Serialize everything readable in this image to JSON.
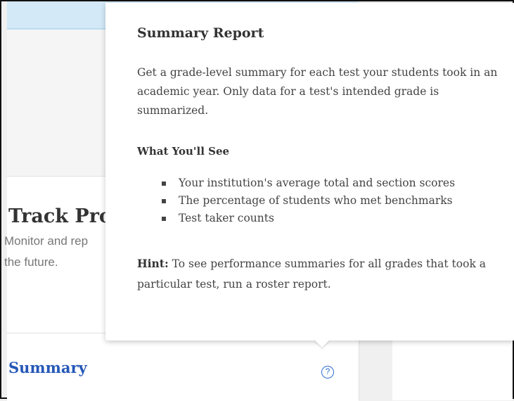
{
  "background": {
    "track_card": {
      "title": "Track Prog",
      "description": "Monitor and rep the future."
    },
    "summary_link": "Summary",
    "help_icon_glyph": "?"
  },
  "popover": {
    "title": "Summary Report",
    "body": "Get a grade-level summary for each test your students took in an academic year. Only data for a test's intended grade is summarized.",
    "subhead": "What You'll See",
    "list_items": [
      "Your institution's average total and section scores",
      "The percentage of students who met benchmarks",
      "Test taker counts"
    ],
    "hint_label": "Hint:",
    "hint_text": " To see performance summaries for all grades that took a particular test, run a roster report."
  },
  "colors": {
    "link": "#2457b7",
    "help_icon": "#2f6fd1",
    "header_strip": "#d3e9f7"
  },
  "icons": {
    "help": "help-icon"
  }
}
